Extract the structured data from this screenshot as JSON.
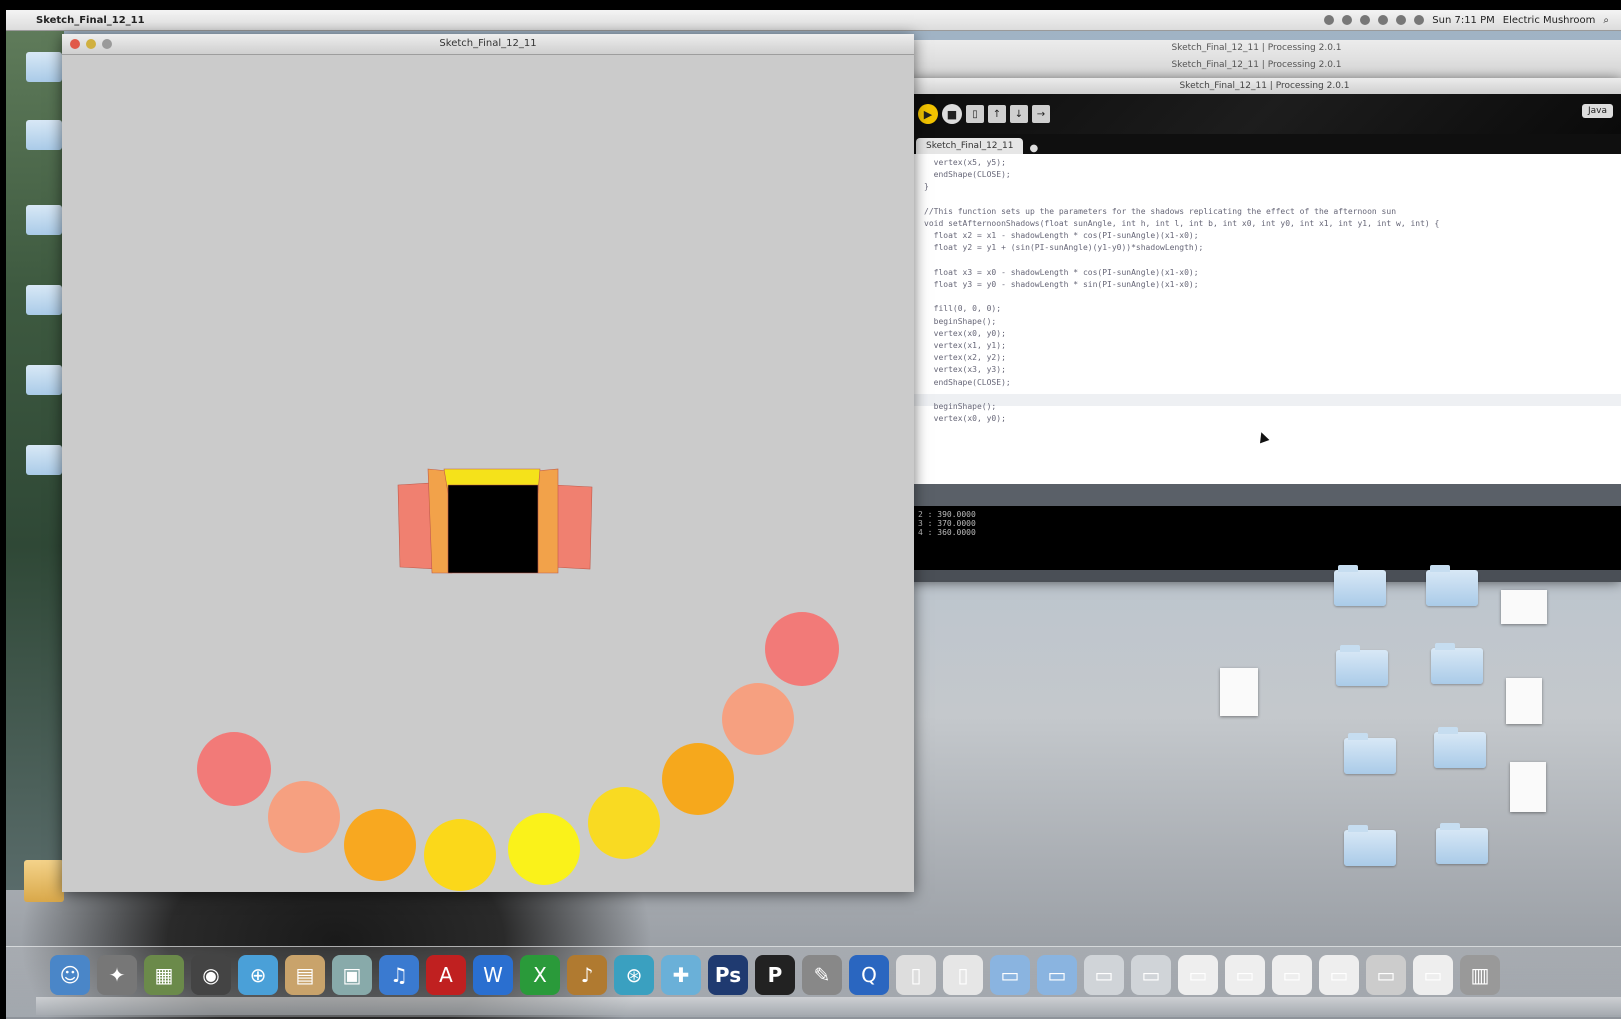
{
  "menubar": {
    "app_name": "Sketch_Final_12_11",
    "clock": "Sun 7:11 PM",
    "user": "Electric Mushroom"
  },
  "sketch_window": {
    "title": "Sketch_Final_12_11",
    "background": "#cbcbcb",
    "window_box": {
      "outer_fill": "#f08070",
      "inner_fill": "#000000",
      "glow_fill": "#f5e21a",
      "frame_fill": "#f2a24a"
    },
    "circles": [
      {
        "color": "#f27a78"
      },
      {
        "color": "#f6a080"
      },
      {
        "color": "#f8a820"
      },
      {
        "color": "#fbd81a"
      },
      {
        "color": "#faf21a"
      },
      {
        "color": "#f9da22"
      },
      {
        "color": "#f6a81c"
      },
      {
        "color": "#f6a080"
      },
      {
        "color": "#f27a78"
      }
    ]
  },
  "ide_behind": {
    "line1": "Sketch_Final_12_11 | Processing 2.0.1",
    "line2": "Sketch_Final_12_11 | Processing 2.0.1"
  },
  "ide": {
    "title": "Sketch_Final_12_11 | Processing 2.0.1",
    "mode": "Java",
    "tab_label": "Sketch_Final_12_11",
    "toolbar": {
      "run_icon": "play-icon",
      "stop_icon": "stop-icon",
      "new_icon": "new-icon",
      "open_icon": "open-icon",
      "save_icon": "save-icon",
      "export_icon": "export-icon"
    },
    "code_lines": [
      "  vertex(x5, y5);",
      "  endShape(CLOSE);",
      "}",
      "",
      "//This function sets up the parameters for the shadows replicating the effect of the afternoon sun",
      "void setAfternoonShadows(float sunAngle, int h, int l, int b, int x0, int y0, int x1, int y1, int w, int) {",
      "  float x2 = x1 - shadowLength * cos(PI-sunAngle)(x1-x0);",
      "  float y2 = y1 + (sin(PI-sunAngle)(y1-y0))*shadowLength);",
      "",
      "  float x3 = x0 - shadowLength * cos(PI-sunAngle)(x1-x0);",
      "  float y3 = y0 - shadowLength * sin(PI-sunAngle)(x1-x0);",
      "",
      "  fill(0, 0, 0);",
      "  beginShape();",
      "  vertex(x0, y0);",
      "  vertex(x1, y1);",
      "  vertex(x2, y2);",
      "  vertex(x3, y3);",
      "  endShape(CLOSE);",
      "",
      "  beginShape();",
      "  vertex(x0, y0);"
    ],
    "console_lines": [
      "2 : 390.0000",
      "3 : 370.0000",
      "4 : 360.0000"
    ]
  },
  "dock": {
    "items": [
      {
        "name": "finder-icon",
        "glyph": "☺",
        "color": "#4a86c8"
      },
      {
        "name": "compass-icon",
        "glyph": "✦",
        "color": "#777"
      },
      {
        "name": "photos-icon",
        "glyph": "▦",
        "color": "#6b8a4a"
      },
      {
        "name": "dashboard-icon",
        "glyph": "◉",
        "color": "#444"
      },
      {
        "name": "safari-icon",
        "glyph": "⊕",
        "color": "#4aa0d8"
      },
      {
        "name": "notes-icon",
        "glyph": "▤",
        "color": "#c9a36b"
      },
      {
        "name": "preview-icon",
        "glyph": "▣",
        "color": "#8aa"
      },
      {
        "name": "itunes-icon",
        "glyph": "♫",
        "color": "#3a7ad0"
      },
      {
        "name": "acrobat-icon",
        "glyph": "A",
        "color": "#c02020"
      },
      {
        "name": "word-icon",
        "glyph": "W",
        "color": "#2a6fd0"
      },
      {
        "name": "excel-icon",
        "glyph": "X",
        "color": "#2a9a3a"
      },
      {
        "name": "guitar-icon",
        "glyph": "♪",
        "color": "#b07a30"
      },
      {
        "name": "network-icon",
        "glyph": "⊛",
        "color": "#3aa0c0"
      },
      {
        "name": "apps-icon",
        "glyph": "✚",
        "color": "#6ab0d8"
      },
      {
        "name": "photoshop-icon",
        "glyph": "Ps",
        "color": "#1f3a70"
      },
      {
        "name": "processing-icon",
        "glyph": "P",
        "color": "#222"
      },
      {
        "name": "script-icon",
        "glyph": "✎",
        "color": "#888"
      },
      {
        "name": "quicktime-icon",
        "glyph": "Q",
        "color": "#2a66c0"
      },
      {
        "name": "document-icon",
        "glyph": "▯",
        "color": "#ddd"
      },
      {
        "name": "document-icon-2",
        "glyph": "▯",
        "color": "#e6e6e6"
      },
      {
        "name": "folder-stack-icon",
        "glyph": "▭",
        "color": "#8ab4e0"
      },
      {
        "name": "folder-stack-icon-2",
        "glyph": "▭",
        "color": "#8ab4e0"
      },
      {
        "name": "window-icon",
        "glyph": "▭",
        "color": "#d0d4d8"
      },
      {
        "name": "window-icon-2",
        "glyph": "▭",
        "color": "#d0d4d8"
      },
      {
        "name": "window-icon-3",
        "glyph": "▭",
        "color": "#eee"
      },
      {
        "name": "window-icon-4",
        "glyph": "▭",
        "color": "#eee"
      },
      {
        "name": "window-icon-5",
        "glyph": "▭",
        "color": "#eee"
      },
      {
        "name": "window-icon-6",
        "glyph": "▭",
        "color": "#eee"
      },
      {
        "name": "window-icon-7",
        "glyph": "▭",
        "color": "#ccc"
      },
      {
        "name": "window-icon-8",
        "glyph": "▭",
        "color": "#eee"
      },
      {
        "name": "trash-icon",
        "glyph": "▥",
        "color": "#999"
      }
    ]
  }
}
